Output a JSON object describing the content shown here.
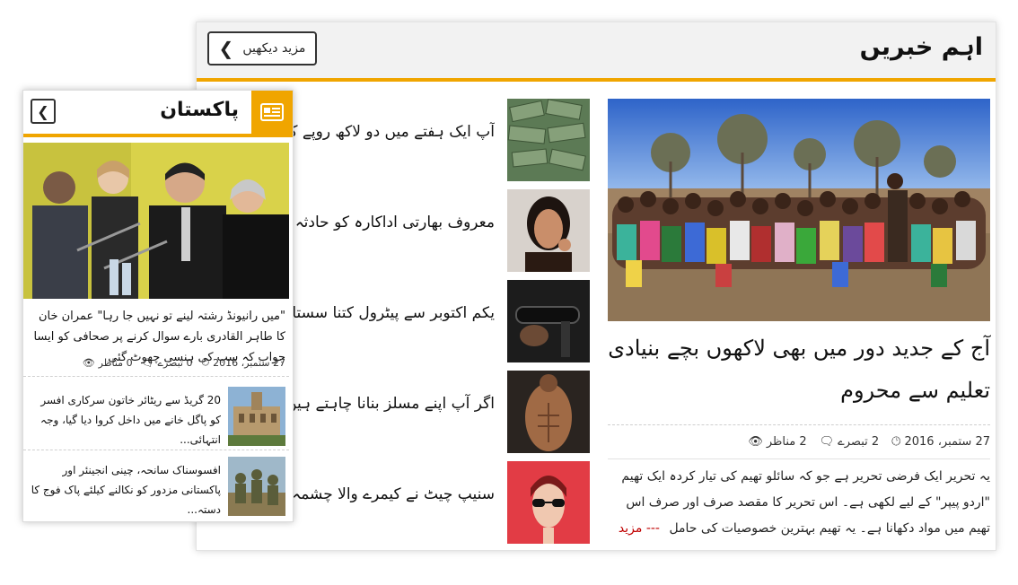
{
  "main": {
    "title": "اہم خبریں",
    "more_label": "مزید دیکھیں",
    "featured": {
      "title": "آج کے جدید دور میں بھی لاکھوں بچے بنیادی تعلیم سے محروم",
      "date": "27 ستمبر، 2016",
      "comments": "2 تبصرے",
      "views": "2 مناظر",
      "excerpt": "یہ تحریر ایک فرضی تحریر ہے جو کہ سائلو تھیم کی تیار کردہ ایک تھیم \"اردو پیپر\" کے لیے لکھی ہے۔ اس تحریر کا مقصد صرف اور صرف اس تھیم میں مواد دکھانا ہے۔ یہ تھیم بہترین خصوصیات کی حامل",
      "read_more": "--- مزید پڑھیں"
    },
    "stories": [
      {
        "title": "آپ ایک ہفتے میں دو لاکھ روپے کمانا چاہتے"
      },
      {
        "title": "معروف بھارتی اداکارہ کو حادثہ پیش آگیا، بری"
      },
      {
        "title": "یکم اکتوبر سے پیٹرول کتنا سستا ہو گا؟ عوام کیلئے"
      },
      {
        "title": "اگر آپ اپنے مسلز بنانا چاہتے ہیں تو یہ قدرتی"
      },
      {
        "title": "سنیپ چیٹ نے کیمرے والا چشمہ تیار کر لیا"
      }
    ]
  },
  "pakistan": {
    "title": "پاکستان",
    "headline": "\"میں رانیونڈ رشتہ لینے تو نہیں جا رہا\" عمران خان کا طاہر القادری بارے سوال کرنے پر صحافی کو ایسا جواب کہ سب کی ہنسی چھوٹ گئی",
    "date": "27 ستمبر، 2016",
    "comments": "0 تبصرے",
    "views": "0 مناظر",
    "items": [
      {
        "title": "20 گریڈ سے ریٹائر خاتون سرکاری افسر کو پاگل خانے میں داخل کروا دیا گیا، وجہ انتہائی..."
      },
      {
        "title": "افسوسناک سانحہ، چینی انجینئر اور پاکستانی مزدور کو نکالنے کیلئے پاک فوج کا دستہ..."
      }
    ]
  },
  "icons": {
    "chevron": "chevron-left-icon",
    "clock": "clock-icon",
    "comment": "comment-icon",
    "eye": "eye-icon",
    "newspaper": "newspaper-icon"
  },
  "colors": {
    "accent": "#f0a500",
    "read_more": "#c00000",
    "header_bg": "#f2f2f2"
  }
}
